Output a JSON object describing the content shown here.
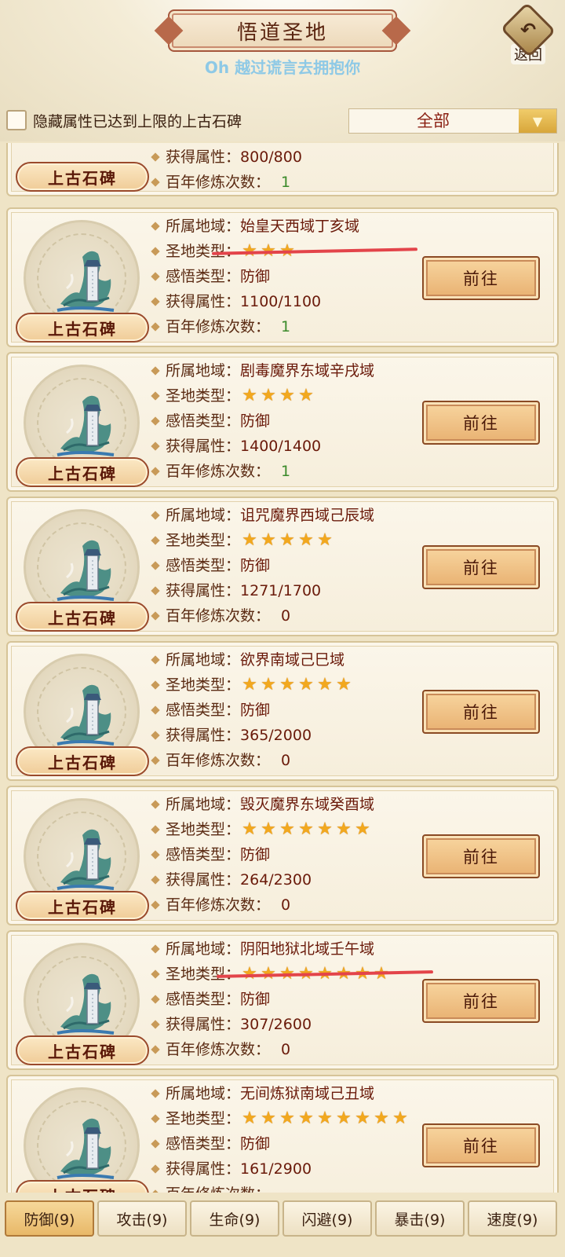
{
  "header": {
    "title": "悟道圣地",
    "subtitle": "Oh 越过谎言去拥抱你",
    "back_label": "返回",
    "back_icon": "back-arrow-icon"
  },
  "filter": {
    "checkbox_label": "隐藏属性已达到上限的上古石碑",
    "checked": false,
    "dropdown_value": "全部"
  },
  "labels": {
    "region": "所属地域：",
    "type": "圣地类型：",
    "insight": "感悟类型：",
    "attr": "获得属性：",
    "count": "百年修炼次数：",
    "goto": "前往",
    "stele_name": "上古石碑"
  },
  "partial_card": {
    "attr": "800/800",
    "count": "1"
  },
  "cards": [
    {
      "region": "始皇天西域丁亥域",
      "stars": 3,
      "insight": "防御",
      "attr": "1100/1100",
      "count": "1"
    },
    {
      "region": "剧毒魔界东域辛戌域",
      "stars": 4,
      "insight": "防御",
      "attr": "1400/1400",
      "count": "1"
    },
    {
      "region": "诅咒魔界西域己辰域",
      "stars": 5,
      "insight": "防御",
      "attr": "1271/1700",
      "count": "0"
    },
    {
      "region": "欲界南域己巳域",
      "stars": 6,
      "insight": "防御",
      "attr": "365/2000",
      "count": "0"
    },
    {
      "region": "毁灭魔界东域癸酉域",
      "stars": 7,
      "insight": "防御",
      "attr": "264/2300",
      "count": "0"
    },
    {
      "region": "阴阳地狱北域壬午域",
      "stars": 8,
      "insight": "防御",
      "attr": "307/2600",
      "count": "0"
    },
    {
      "region": "无间炼狱南域己丑域",
      "stars": 9,
      "insight": "防御",
      "attr": "161/2900",
      "count": ""
    }
  ],
  "tabs": [
    {
      "label": "防御(9)",
      "active": true
    },
    {
      "label": "攻击(9)",
      "active": false
    },
    {
      "label": "生命(9)",
      "active": false
    },
    {
      "label": "闪避(9)",
      "active": false
    },
    {
      "label": "暴击(9)",
      "active": false
    },
    {
      "label": "速度(9)",
      "active": false
    }
  ],
  "colors": {
    "star": "#f2a81e",
    "annotation_line": "#e3444a",
    "count_nonzero": "#3a8a2a"
  }
}
